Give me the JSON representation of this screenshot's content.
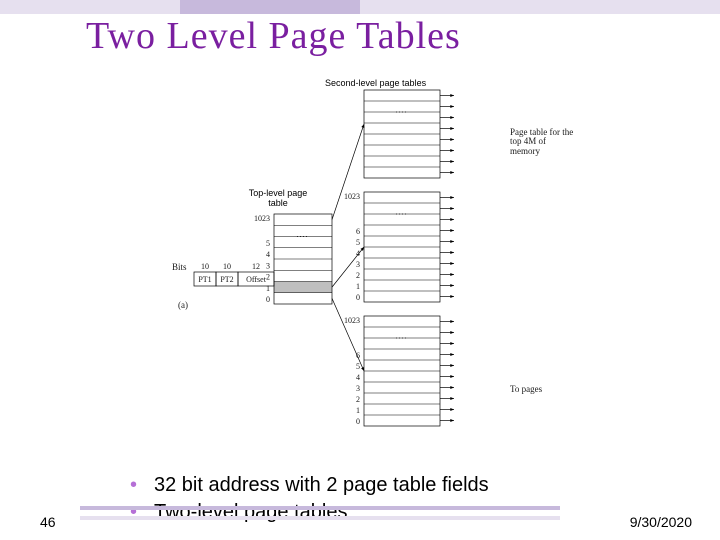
{
  "title": "Two Level Page Tables",
  "diagram": {
    "second_label": "Second-level page tables",
    "top_label": "Top-level\npage table",
    "right_label": "Page table for the top 4M of memory",
    "to_pages_label": "To pages",
    "bits_label": "Bits",
    "subfig": "(a)",
    "addr_cols": [
      "PT1",
      "PT2",
      "Offset"
    ],
    "addr_widths": [
      "10",
      "10",
      "12"
    ],
    "top_numbers": [
      "1023",
      "5",
      "4",
      "3",
      "2",
      "1",
      "0"
    ],
    "second_numbers": [
      "1023",
      "6",
      "5",
      "4",
      "3",
      "2",
      "1",
      "0"
    ]
  },
  "bullets": [
    "32 bit address with 2 page table fields",
    "Two-level page tables"
  ],
  "footer": {
    "left": "46",
    "right": "9/30/2020"
  }
}
